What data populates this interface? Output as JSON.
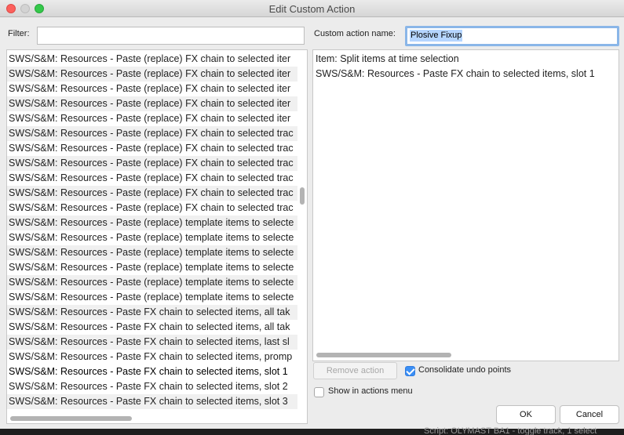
{
  "window": {
    "title": "Edit Custom Action"
  },
  "filter": {
    "label": "Filter:",
    "value": ""
  },
  "custom_action": {
    "label": "Custom action name:",
    "value": "Plosive Fixup"
  },
  "action_list": [
    "SWS/S&M: Resources - Paste (replace) FX chain to selected iter",
    "SWS/S&M: Resources - Paste (replace) FX chain to selected iter",
    "SWS/S&M: Resources - Paste (replace) FX chain to selected iter",
    "SWS/S&M: Resources - Paste (replace) FX chain to selected iter",
    "SWS/S&M: Resources - Paste (replace) FX chain to selected iter",
    "SWS/S&M: Resources - Paste (replace) FX chain to selected trac",
    "SWS/S&M: Resources - Paste (replace) FX chain to selected trac",
    "SWS/S&M: Resources - Paste (replace) FX chain to selected trac",
    "SWS/S&M: Resources - Paste (replace) FX chain to selected trac",
    "SWS/S&M: Resources - Paste (replace) FX chain to selected trac",
    "SWS/S&M: Resources - Paste (replace) FX chain to selected trac",
    "SWS/S&M: Resources - Paste (replace) template items to selecte",
    "SWS/S&M: Resources - Paste (replace) template items to selecte",
    "SWS/S&M: Resources - Paste (replace) template items to selecte",
    "SWS/S&M: Resources - Paste (replace) template items to selecte",
    "SWS/S&M: Resources - Paste (replace) template items to selecte",
    "SWS/S&M: Resources - Paste (replace) template items to selecte",
    "SWS/S&M: Resources - Paste FX chain to selected items, all tak",
    "SWS/S&M: Resources - Paste FX chain to selected items, all tak",
    "SWS/S&M: Resources - Paste FX chain to selected items, last sl",
    "SWS/S&M: Resources - Paste FX chain to selected items, promp",
    "SWS/S&M: Resources - Paste FX chain to selected items, slot 1",
    "SWS/S&M: Resources - Paste FX chain to selected items, slot 2",
    "SWS/S&M: Resources - Paste FX chain to selected items, slot 3"
  ],
  "steps": [
    "Item: Split items at time selection",
    "SWS/S&M: Resources - Paste FX chain to selected items, slot 1"
  ],
  "buttons": {
    "remove": "Remove action",
    "ok": "OK",
    "cancel": "Cancel"
  },
  "options": {
    "consolidate_label": "Consolidate undo points",
    "consolidate_checked": true,
    "show_menu_label": "Show in actions menu",
    "show_menu_checked": false
  },
  "background_text": "Script: OLYMAST BA1 - toggle track, 1 select",
  "colors": {
    "accent": "#3b8ff5",
    "selection_highlight": "#b5d5ff",
    "close": "#fc605c",
    "zoom": "#34c84a"
  }
}
